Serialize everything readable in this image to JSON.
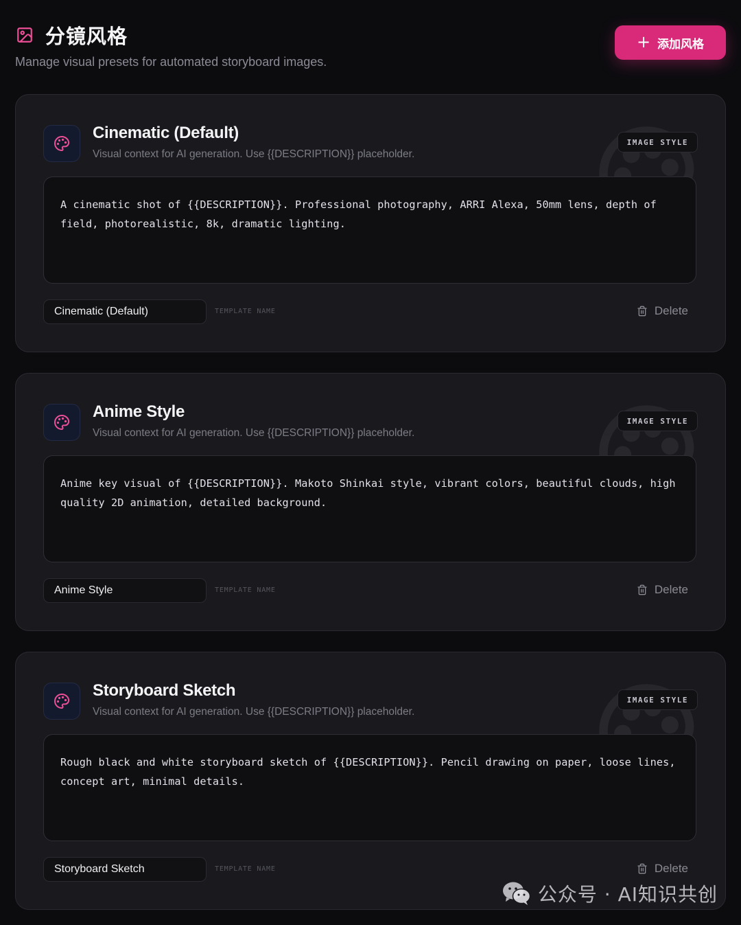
{
  "header": {
    "title": "分镜风格",
    "subtitle": "Manage visual presets for automated storyboard images.",
    "add_button_label": "添加风格"
  },
  "cards": [
    {
      "title": "Cinematic (Default)",
      "description": "Visual context for AI generation. Use {{DESCRIPTION}} placeholder.",
      "badge": "IMAGE STYLE",
      "prompt": "A cinematic shot of {{DESCRIPTION}}. Professional photography, ARRI Alexa, 50mm lens, depth of field, photorealistic, 8k, dramatic lighting.",
      "template_name": "Cinematic (Default)",
      "template_name_label": "TEMPLATE NAME",
      "delete_label": "Delete"
    },
    {
      "title": "Anime Style",
      "description": "Visual context for AI generation. Use {{DESCRIPTION}} placeholder.",
      "badge": "IMAGE STYLE",
      "prompt": "Anime key visual of {{DESCRIPTION}}. Makoto Shinkai style, vibrant colors, beautiful clouds, high quality 2D animation, detailed background.",
      "template_name": "Anime Style",
      "template_name_label": "TEMPLATE NAME",
      "delete_label": "Delete"
    },
    {
      "title": "Storyboard Sketch",
      "description": "Visual context for AI generation. Use {{DESCRIPTION}} placeholder.",
      "badge": "IMAGE STYLE",
      "prompt": "Rough black and white storyboard sketch of {{DESCRIPTION}}. Pencil drawing on paper, loose lines, concept art, minimal details.",
      "template_name": "Storyboard Sketch",
      "template_name_label": "TEMPLATE NAME",
      "delete_label": "Delete"
    }
  ],
  "watermark": {
    "text": "公众号 · AI知识共创"
  },
  "colors": {
    "accent": "#d92a7a",
    "icon_pink": "#ec4f95",
    "background": "#0c0c0f",
    "card": "#1a1a1e"
  },
  "icons": {
    "title": "image-icon",
    "card": "palette-icon",
    "add": "plus-icon",
    "delete": "trash-icon",
    "watermark": "wechat-icon"
  }
}
